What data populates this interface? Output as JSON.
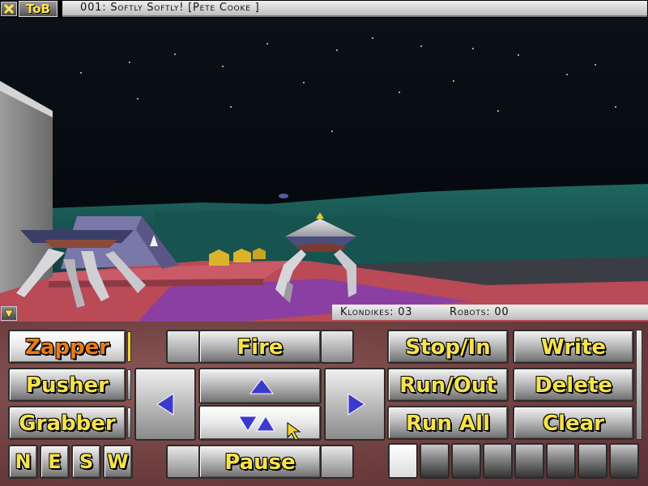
{
  "header": {
    "close_icon": "x-icon",
    "badge": "ToB",
    "level_title": "001: Softly Softly! [Pete Cooke ]"
  },
  "status": {
    "collapse_icon": "chevron-down-icon",
    "klondikes": "Klondikes: 03",
    "robots": "Robots: 00"
  },
  "tools": {
    "zapper": "Zapper",
    "pusher": "Pusher",
    "grabber": "Grabber",
    "selected": "Zapper"
  },
  "directions": [
    "N",
    "E",
    "S",
    "W"
  ],
  "movement": {
    "fire": "Fire",
    "pause": "Pause",
    "left_icon": "arrow-left-icon",
    "right_icon": "arrow-right-icon",
    "forward_icon": "arrow-up-icon",
    "turn_icon": "turn-around-icon"
  },
  "program": {
    "stop_in": "Stop/In",
    "run_out": "Run/Out",
    "run_all": "Run All",
    "write": "Write",
    "delete": "Delete",
    "clear": "Clear",
    "slots_total": 8,
    "slot_selected": 1
  },
  "colors": {
    "label": "#f6e24a",
    "selected_label": "#e87b1a",
    "panel": "#6f3f40",
    "sky": "#05070d"
  }
}
